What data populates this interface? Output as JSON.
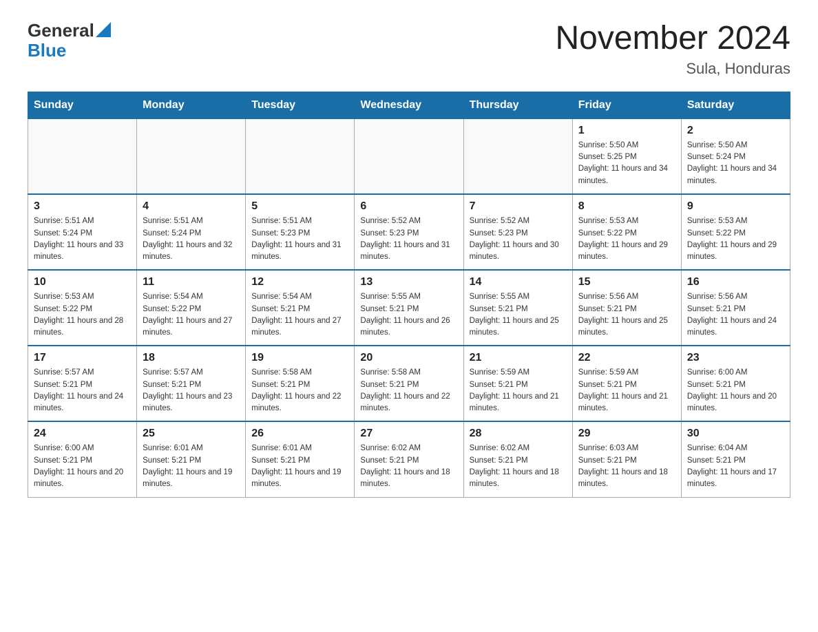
{
  "header": {
    "logo": {
      "general": "General",
      "blue": "Blue"
    },
    "title": "November 2024",
    "subtitle": "Sula, Honduras"
  },
  "weekdays": [
    "Sunday",
    "Monday",
    "Tuesday",
    "Wednesday",
    "Thursday",
    "Friday",
    "Saturday"
  ],
  "weeks": [
    {
      "days": [
        {
          "num": "",
          "sunrise": "",
          "sunset": "",
          "daylight": ""
        },
        {
          "num": "",
          "sunrise": "",
          "sunset": "",
          "daylight": ""
        },
        {
          "num": "",
          "sunrise": "",
          "sunset": "",
          "daylight": ""
        },
        {
          "num": "",
          "sunrise": "",
          "sunset": "",
          "daylight": ""
        },
        {
          "num": "",
          "sunrise": "",
          "sunset": "",
          "daylight": ""
        },
        {
          "num": "1",
          "sunrise": "Sunrise: 5:50 AM",
          "sunset": "Sunset: 5:25 PM",
          "daylight": "Daylight: 11 hours and 34 minutes."
        },
        {
          "num": "2",
          "sunrise": "Sunrise: 5:50 AM",
          "sunset": "Sunset: 5:24 PM",
          "daylight": "Daylight: 11 hours and 34 minutes."
        }
      ]
    },
    {
      "days": [
        {
          "num": "3",
          "sunrise": "Sunrise: 5:51 AM",
          "sunset": "Sunset: 5:24 PM",
          "daylight": "Daylight: 11 hours and 33 minutes."
        },
        {
          "num": "4",
          "sunrise": "Sunrise: 5:51 AM",
          "sunset": "Sunset: 5:24 PM",
          "daylight": "Daylight: 11 hours and 32 minutes."
        },
        {
          "num": "5",
          "sunrise": "Sunrise: 5:51 AM",
          "sunset": "Sunset: 5:23 PM",
          "daylight": "Daylight: 11 hours and 31 minutes."
        },
        {
          "num": "6",
          "sunrise": "Sunrise: 5:52 AM",
          "sunset": "Sunset: 5:23 PM",
          "daylight": "Daylight: 11 hours and 31 minutes."
        },
        {
          "num": "7",
          "sunrise": "Sunrise: 5:52 AM",
          "sunset": "Sunset: 5:23 PM",
          "daylight": "Daylight: 11 hours and 30 minutes."
        },
        {
          "num": "8",
          "sunrise": "Sunrise: 5:53 AM",
          "sunset": "Sunset: 5:22 PM",
          "daylight": "Daylight: 11 hours and 29 minutes."
        },
        {
          "num": "9",
          "sunrise": "Sunrise: 5:53 AM",
          "sunset": "Sunset: 5:22 PM",
          "daylight": "Daylight: 11 hours and 29 minutes."
        }
      ]
    },
    {
      "days": [
        {
          "num": "10",
          "sunrise": "Sunrise: 5:53 AM",
          "sunset": "Sunset: 5:22 PM",
          "daylight": "Daylight: 11 hours and 28 minutes."
        },
        {
          "num": "11",
          "sunrise": "Sunrise: 5:54 AM",
          "sunset": "Sunset: 5:22 PM",
          "daylight": "Daylight: 11 hours and 27 minutes."
        },
        {
          "num": "12",
          "sunrise": "Sunrise: 5:54 AM",
          "sunset": "Sunset: 5:21 PM",
          "daylight": "Daylight: 11 hours and 27 minutes."
        },
        {
          "num": "13",
          "sunrise": "Sunrise: 5:55 AM",
          "sunset": "Sunset: 5:21 PM",
          "daylight": "Daylight: 11 hours and 26 minutes."
        },
        {
          "num": "14",
          "sunrise": "Sunrise: 5:55 AM",
          "sunset": "Sunset: 5:21 PM",
          "daylight": "Daylight: 11 hours and 25 minutes."
        },
        {
          "num": "15",
          "sunrise": "Sunrise: 5:56 AM",
          "sunset": "Sunset: 5:21 PM",
          "daylight": "Daylight: 11 hours and 25 minutes."
        },
        {
          "num": "16",
          "sunrise": "Sunrise: 5:56 AM",
          "sunset": "Sunset: 5:21 PM",
          "daylight": "Daylight: 11 hours and 24 minutes."
        }
      ]
    },
    {
      "days": [
        {
          "num": "17",
          "sunrise": "Sunrise: 5:57 AM",
          "sunset": "Sunset: 5:21 PM",
          "daylight": "Daylight: 11 hours and 24 minutes."
        },
        {
          "num": "18",
          "sunrise": "Sunrise: 5:57 AM",
          "sunset": "Sunset: 5:21 PM",
          "daylight": "Daylight: 11 hours and 23 minutes."
        },
        {
          "num": "19",
          "sunrise": "Sunrise: 5:58 AM",
          "sunset": "Sunset: 5:21 PM",
          "daylight": "Daylight: 11 hours and 22 minutes."
        },
        {
          "num": "20",
          "sunrise": "Sunrise: 5:58 AM",
          "sunset": "Sunset: 5:21 PM",
          "daylight": "Daylight: 11 hours and 22 minutes."
        },
        {
          "num": "21",
          "sunrise": "Sunrise: 5:59 AM",
          "sunset": "Sunset: 5:21 PM",
          "daylight": "Daylight: 11 hours and 21 minutes."
        },
        {
          "num": "22",
          "sunrise": "Sunrise: 5:59 AM",
          "sunset": "Sunset: 5:21 PM",
          "daylight": "Daylight: 11 hours and 21 minutes."
        },
        {
          "num": "23",
          "sunrise": "Sunrise: 6:00 AM",
          "sunset": "Sunset: 5:21 PM",
          "daylight": "Daylight: 11 hours and 20 minutes."
        }
      ]
    },
    {
      "days": [
        {
          "num": "24",
          "sunrise": "Sunrise: 6:00 AM",
          "sunset": "Sunset: 5:21 PM",
          "daylight": "Daylight: 11 hours and 20 minutes."
        },
        {
          "num": "25",
          "sunrise": "Sunrise: 6:01 AM",
          "sunset": "Sunset: 5:21 PM",
          "daylight": "Daylight: 11 hours and 19 minutes."
        },
        {
          "num": "26",
          "sunrise": "Sunrise: 6:01 AM",
          "sunset": "Sunset: 5:21 PM",
          "daylight": "Daylight: 11 hours and 19 minutes."
        },
        {
          "num": "27",
          "sunrise": "Sunrise: 6:02 AM",
          "sunset": "Sunset: 5:21 PM",
          "daylight": "Daylight: 11 hours and 18 minutes."
        },
        {
          "num": "28",
          "sunrise": "Sunrise: 6:02 AM",
          "sunset": "Sunset: 5:21 PM",
          "daylight": "Daylight: 11 hours and 18 minutes."
        },
        {
          "num": "29",
          "sunrise": "Sunrise: 6:03 AM",
          "sunset": "Sunset: 5:21 PM",
          "daylight": "Daylight: 11 hours and 18 minutes."
        },
        {
          "num": "30",
          "sunrise": "Sunrise: 6:04 AM",
          "sunset": "Sunset: 5:21 PM",
          "daylight": "Daylight: 11 hours and 17 minutes."
        }
      ]
    }
  ]
}
